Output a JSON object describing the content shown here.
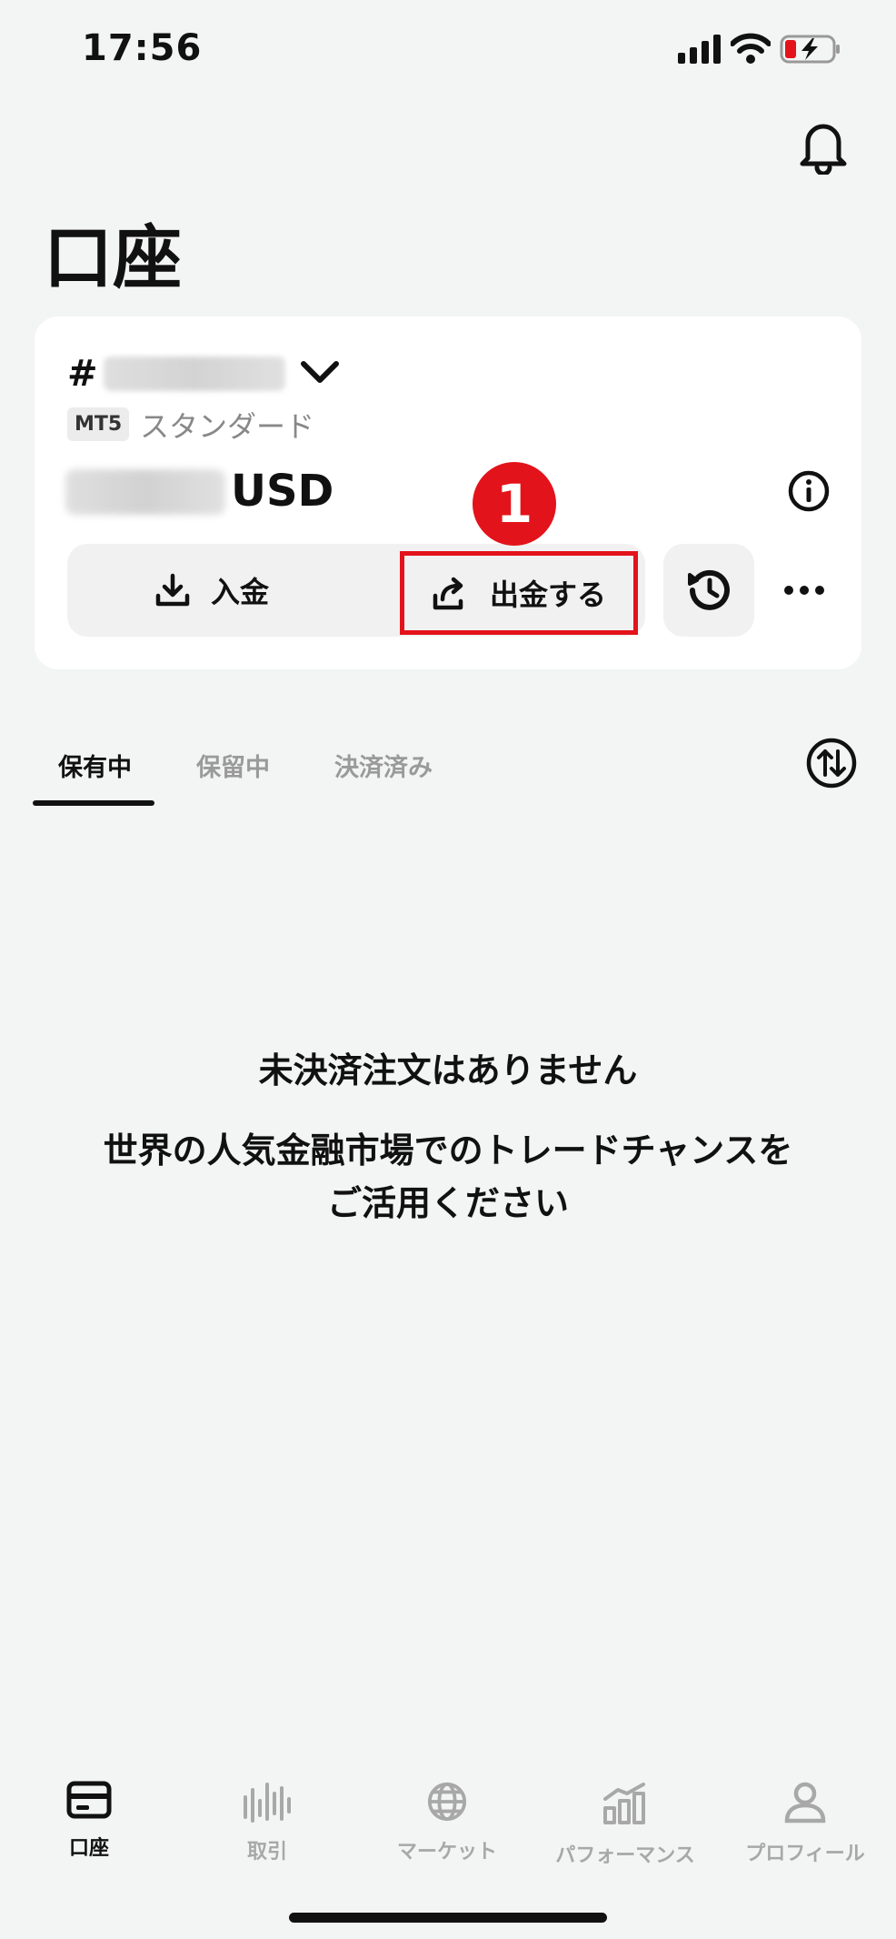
{
  "status_bar": {
    "time": "17:56"
  },
  "page": {
    "title": "口座"
  },
  "account": {
    "id_prefix": "#",
    "platform_badge": "MT5",
    "account_type": "スタンダード",
    "currency": "USD"
  },
  "actions": {
    "deposit_label": "入金",
    "withdraw_label": "出金する",
    "step_number": "1"
  },
  "tabs": [
    {
      "label": "保有中",
      "active": true
    },
    {
      "label": "保留中",
      "active": false
    },
    {
      "label": "決済済み",
      "active": false
    }
  ],
  "empty_state": {
    "title": "未決済注文はありません",
    "description": "世界の人気金融市場でのトレードチャンスをご活用ください"
  },
  "bottom_nav": [
    {
      "label": "口座",
      "icon": "card-icon",
      "active": true
    },
    {
      "label": "取引",
      "icon": "candles-icon",
      "active": false
    },
    {
      "label": "マーケット",
      "icon": "globe-icon",
      "active": false
    },
    {
      "label": "パフォーマンス",
      "icon": "performance-chart-icon",
      "active": false
    },
    {
      "label": "プロフィール",
      "icon": "person-icon",
      "active": false
    }
  ],
  "colors": {
    "accent_red": "#e3131b",
    "background": "#f3f4f4"
  }
}
